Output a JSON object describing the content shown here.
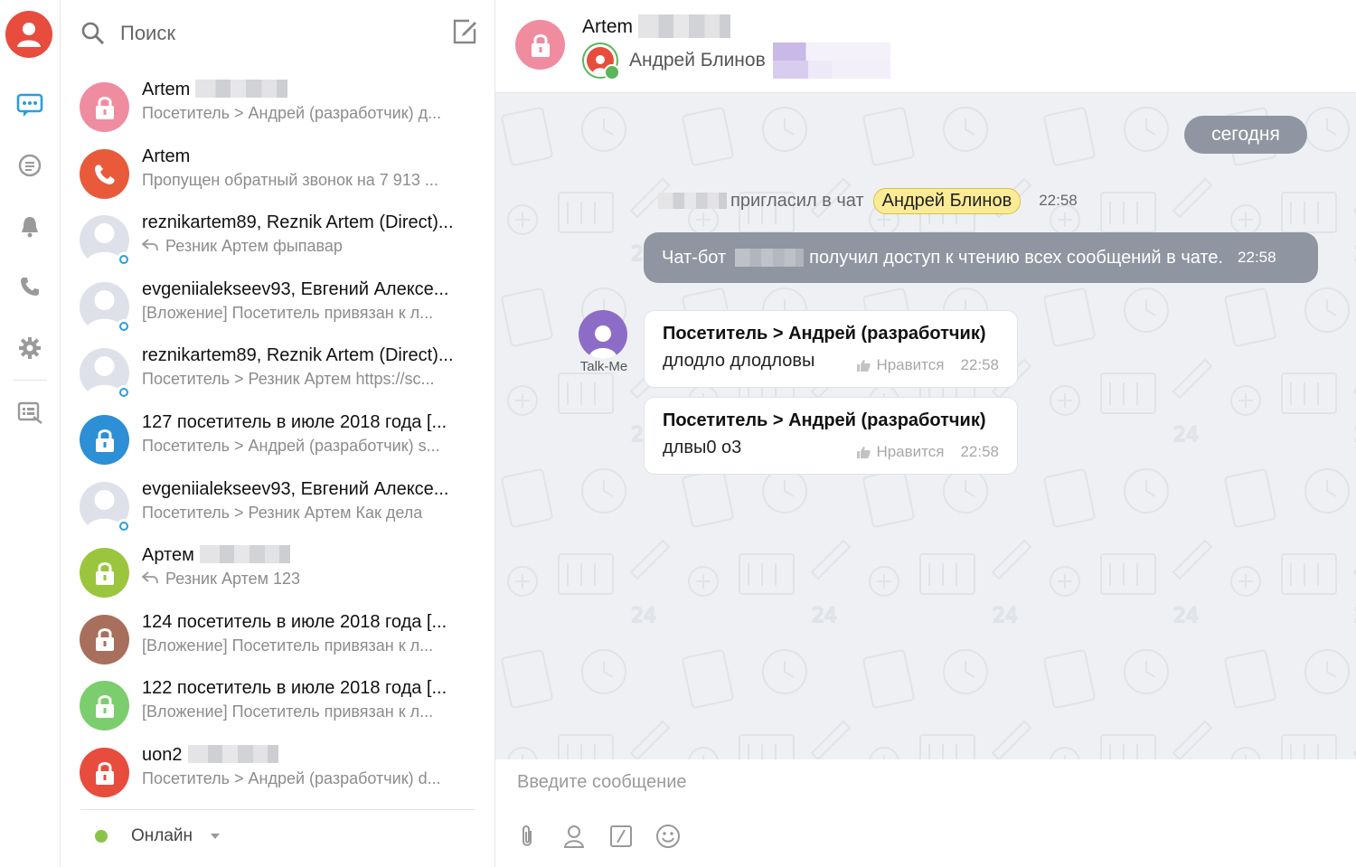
{
  "search": {
    "placeholder": "Поиск"
  },
  "chats": [
    {
      "title": "Artem",
      "subtitle": "Посетитель > Андрей (разработчик) д...",
      "avatar_type": "lock",
      "avatar_color": "#f08ca0"
    },
    {
      "title": "Artem",
      "subtitle": "Пропущен обратный звонок на 7 913 ...",
      "avatar_type": "phone",
      "avatar_color": "#e85a3a"
    },
    {
      "title": "reznikartem89, Reznik Artem (Direct)...",
      "subtitle": "Резник Артем фыпавар",
      "avatar_type": "person",
      "avatar_color": "#dfe1ea"
    },
    {
      "title": "evgeniialekseev93, Евгений Алексе...",
      "subtitle": "[Вложение] Посетитель привязан к л...",
      "avatar_type": "person",
      "avatar_color": "#dfe1ea"
    },
    {
      "title": "reznikartem89, Reznik Artem (Direct)...",
      "subtitle": "Посетитель > Резник Артем https://sc...",
      "avatar_type": "person",
      "avatar_color": "#dfe1ea"
    },
    {
      "title": "127 посетитель в июле 2018 года [...",
      "subtitle": "Посетитель > Андрей (разработчик) s...",
      "avatar_type": "lock",
      "avatar_color": "#2d8fd5"
    },
    {
      "title": "evgeniialekseev93, Евгений Алексе...",
      "subtitle": "Посетитель > Резник Артем Как дела",
      "avatar_type": "person",
      "avatar_color": "#dfe1ea"
    },
    {
      "title": "Артем",
      "subtitle": "Резник Артем 123",
      "avatar_type": "lock",
      "avatar_color": "#9bc53d"
    },
    {
      "title": "124 посетитель в июле 2018 года [...",
      "subtitle": "[Вложение] Посетитель привязан к л...",
      "avatar_type": "lock",
      "avatar_color": "#a86f5c"
    },
    {
      "title": "122 посетитель в июле 2018 года [...",
      "subtitle": "[Вложение] Посетитель привязан к л...",
      "avatar_type": "lock",
      "avatar_color": "#7ccd6e"
    },
    {
      "title": "uon2",
      "subtitle": "Посетитель > Андрей (разработчик) d...",
      "avatar_type": "lock",
      "avatar_color": "#e84c3d"
    }
  ],
  "status": {
    "label": "Онлайн",
    "color": "#8bc34a"
  },
  "chat": {
    "title": "Artem",
    "operator": "Андрей Блинов",
    "date": "сегодня",
    "system_invite": {
      "text": "пригласил в чат",
      "name": "Андрей Блинов",
      "time": "22:58"
    },
    "system_bot": {
      "prefix": "Чат-бот",
      "text": "получил доступ к чтению всех сообщений в чате.",
      "time": "22:58"
    },
    "bot_name": "Talk-Me",
    "messages": [
      {
        "from": "Посетитель > Андрей (разработчик)",
        "text": "длодло длодловы",
        "like": "Нравится",
        "time": "22:58"
      },
      {
        "from": "Посетитель > Андрей (разработчик)",
        "text": "длвы0 о3",
        "like": "Нравится",
        "time": "22:58"
      }
    ]
  },
  "composer": {
    "placeholder": "Введите сообщение"
  },
  "colors": {
    "accent": "#2d9cdb",
    "system_bubble": "#8f96a1",
    "chip": "#fbeb96"
  }
}
